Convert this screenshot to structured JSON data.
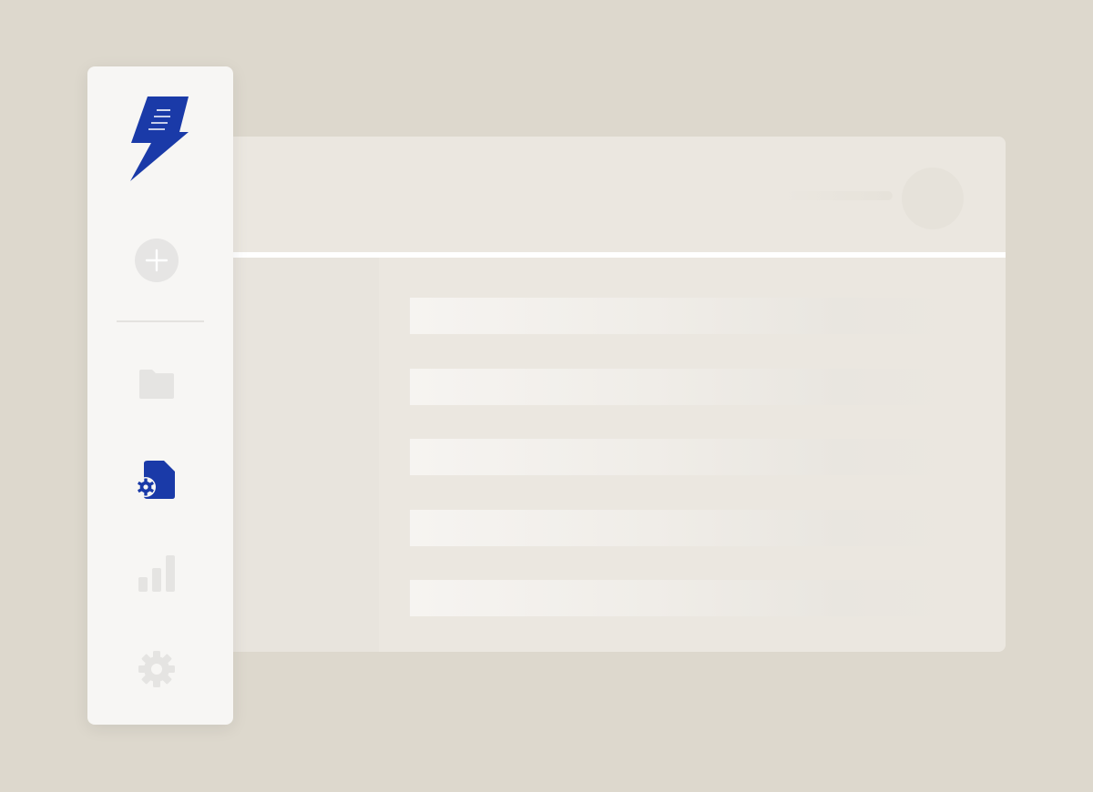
{
  "app": {
    "brand_color": "#1a3aa8",
    "muted_icon_color": "#e5e4e2"
  },
  "sidebar": {
    "logo_icon": "lightning-document-icon",
    "items": [
      {
        "id": "add",
        "icon": "plus-icon",
        "active": false
      },
      {
        "id": "folders",
        "icon": "folder-icon",
        "active": false
      },
      {
        "id": "document-settings",
        "icon": "document-gear-icon",
        "active": true
      },
      {
        "id": "analytics",
        "icon": "bar-chart-icon",
        "active": false
      },
      {
        "id": "settings",
        "icon": "gear-icon",
        "active": false
      }
    ]
  },
  "main": {
    "header": {
      "avatar_icon": "avatar"
    },
    "rows": [
      {
        "id": "row-1"
      },
      {
        "id": "row-2"
      },
      {
        "id": "row-3"
      },
      {
        "id": "row-4"
      },
      {
        "id": "row-5"
      }
    ]
  }
}
